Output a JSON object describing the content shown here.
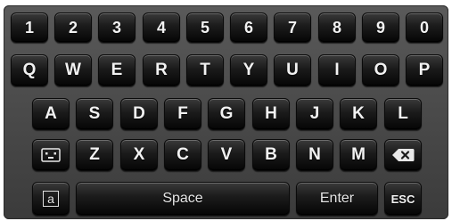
{
  "keyboard": {
    "row1": [
      "1",
      "2",
      "3",
      "4",
      "5",
      "6",
      "7",
      "8",
      "9",
      "0"
    ],
    "row2": [
      "Q",
      "W",
      "E",
      "R",
      "T",
      "Y",
      "U",
      "I",
      "O",
      "P"
    ],
    "row3": [
      "A",
      "S",
      "D",
      "F",
      "G",
      "H",
      "J",
      "K",
      "L"
    ],
    "row4": [
      "Z",
      "X",
      "C",
      "V",
      "B",
      "N",
      "M"
    ],
    "row4_left_icon": "keyboard-toggle-icon",
    "row4_right_icon": "backspace-icon",
    "bottom": {
      "left_key": "a",
      "space": "Space",
      "enter": "Enter",
      "esc": "ESC"
    }
  }
}
